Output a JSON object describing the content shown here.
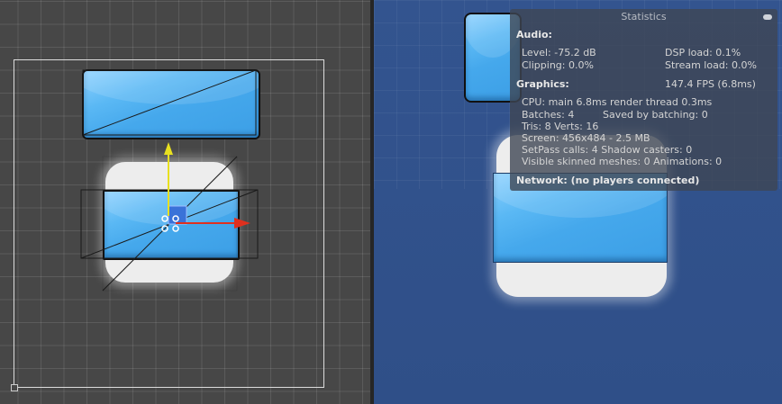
{
  "statistics": {
    "title": "Statistics",
    "audio": {
      "header": "Audio:",
      "level": "Level: -75.2 dB",
      "clipping": "Clipping: 0.0%",
      "dsp_load": "DSP load: 0.1%",
      "stream_load": "Stream load: 0.0%"
    },
    "graphics": {
      "header": "Graphics:",
      "fps": "147.4 FPS (6.8ms)",
      "cpu": "CPU: main 6.8ms  render thread 0.3ms",
      "batches": "Batches: 4",
      "saved_by_batching": "Saved by batching: 0",
      "tris": "Tris: 8  Verts: 16",
      "screen": "Screen: 456x484 - 2.5 MB",
      "setpass": "SetPass calls: 4  Shadow casters: 0",
      "skinned": "Visible skinned meshes: 0  Animations: 0"
    },
    "network": "Network: (no players connected)"
  },
  "colors": {
    "highlight": "#e0182d",
    "button_blue": "#45a8ec",
    "gizmo_y": "#e8e020",
    "gizmo_x": "#e0301e",
    "game_bg": "#33548f",
    "scene_bg": "#474747"
  }
}
